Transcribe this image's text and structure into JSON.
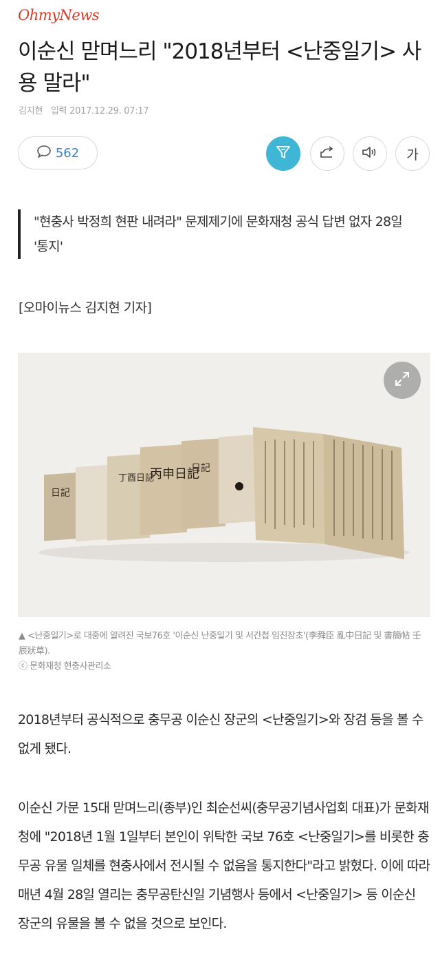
{
  "header": {
    "logo": "OhmyNews"
  },
  "article": {
    "title": "이순신 맏며느리 \"2018년부터 <난중일기> 사용 말라\"",
    "author": "김지현",
    "date_label": "입력",
    "date": "2017.12.29. 07:17",
    "comment_count": "562",
    "subtitle": "\"현충사 박정희 현판 내려라\" 문제제기에 문화재청 공식 답변 없자 28일 '통지'",
    "reporter_line": "[오마이뉴스 김지현 기자]",
    "caption_line1": "▲  <난중일기>로 대중에 알려진 국보76호 '이순신 난중일기 및 서간첩 임진장초'(李舜臣 亂中日記 및 書簡帖 壬辰狀草).",
    "caption_credit": "ⓒ 문화재청 현충사관리소",
    "paragraphs": [
      "2018년부터 공식적으로 충무공 이순신 장군의 <난중일기>와 장검 등을 볼 수 없게 됐다.",
      "이순신 가문 15대 맏며느리(종부)인 최순선씨(충무공기념사업회 대표)가 문화재청에 \"2018년 1월 1일부터 본인이 위탁한 국보 76호 <난중일기>를 비롯한 충무공 유물 일체를 현충사에서 전시될 수 없음을 통지한다\"라고 밝혔다. 이에 따라 매년 4월 28일 열리는 충무공탄신일 기념행사 등에서 <난중일기> 등 이순신 장군의 유물을 볼 수 없을 것으로 보인다."
    ]
  },
  "toolbar": {
    "font_label": "가",
    "icons": [
      "speech-bubble-icon",
      "filter-icon",
      "share-icon",
      "speaker-icon"
    ]
  },
  "image": {
    "book_labels": [
      "日記",
      "丁酉日記",
      "丙申日記",
      "日記"
    ]
  },
  "colors": {
    "logo": "#d83a2a",
    "accent_blue": "#3a82d6",
    "filter_active": "#3fb6d5"
  }
}
